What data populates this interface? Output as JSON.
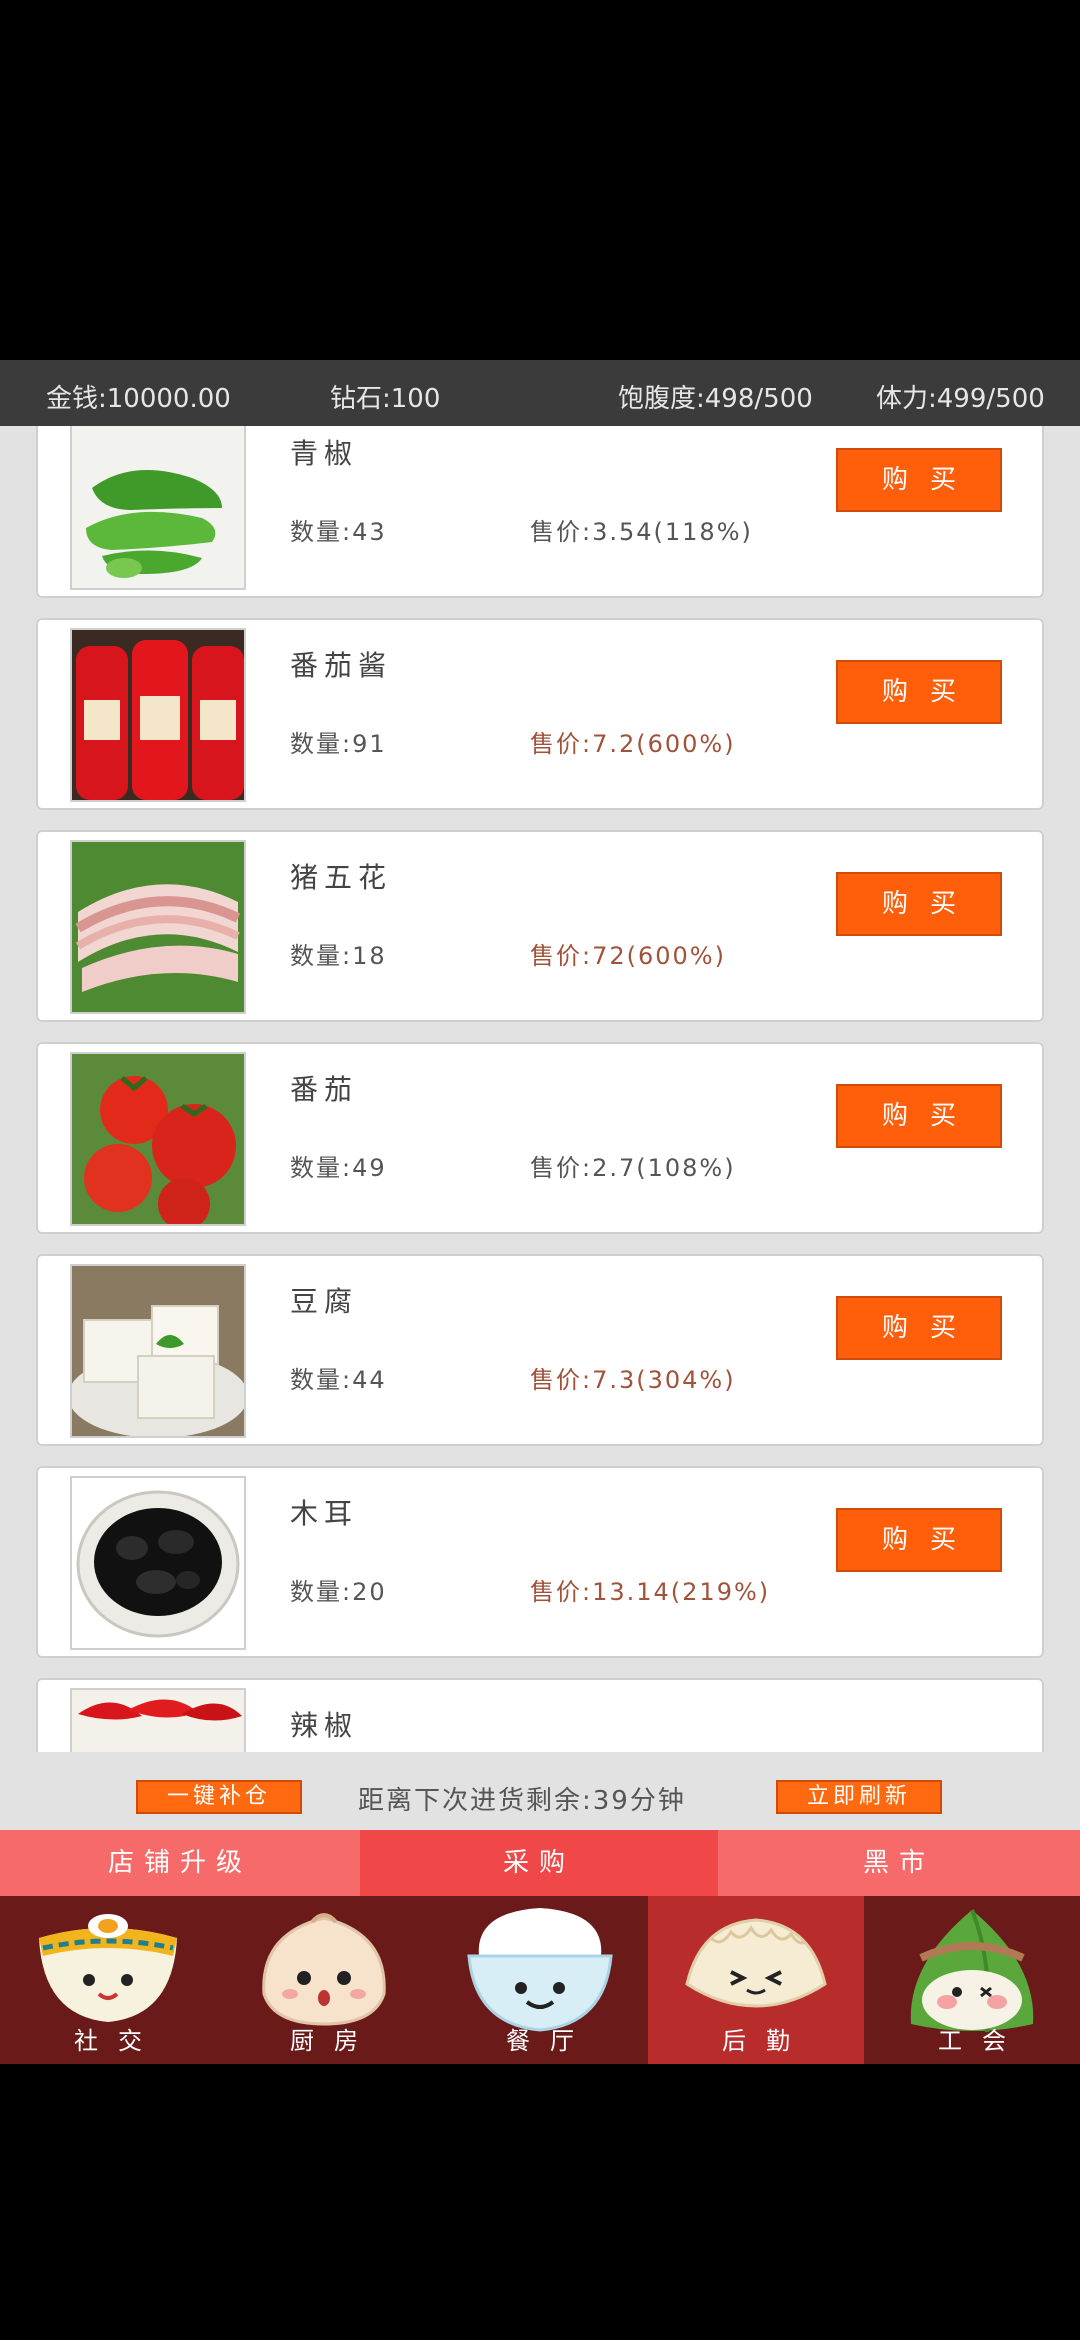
{
  "stats": {
    "money": "金钱:10000.00",
    "diamond": "钻石:100",
    "fullness": "饱腹度:498/500",
    "stamina": "体力:499/500"
  },
  "items": [
    {
      "name": "青椒",
      "qty": "数量:43",
      "price": "售价:3.54(118%)",
      "price_high": false,
      "image": "green-pepper",
      "buy": "购买"
    },
    {
      "name": "番茄酱",
      "qty": "数量:91",
      "price": "售价:7.2(600%)",
      "price_high": true,
      "image": "ketchup",
      "buy": "购买"
    },
    {
      "name": "猪五花",
      "qty": "数量:18",
      "price": "售价:72(600%)",
      "price_high": true,
      "image": "pork-belly",
      "buy": "购买"
    },
    {
      "name": "番茄",
      "qty": "数量:49",
      "price": "售价:2.7(108%)",
      "price_high": false,
      "image": "tomato",
      "buy": "购买"
    },
    {
      "name": "豆腐",
      "qty": "数量:44",
      "price": "售价:7.3(304%)",
      "price_high": true,
      "image": "tofu",
      "buy": "购买"
    },
    {
      "name": "木耳",
      "qty": "数量:20",
      "price": "售价:13.14(219%)",
      "price_high": true,
      "image": "wood-ear",
      "buy": "购买"
    },
    {
      "name": "辣椒",
      "qty": "",
      "price": "",
      "price_high": false,
      "image": "chili",
      "buy": ""
    }
  ],
  "actions": {
    "restock": "一键补仓",
    "countdown": "距离下次进货剩余:39分钟",
    "refresh": "立即刷新"
  },
  "tabs": [
    {
      "label": "店铺升级",
      "active": false
    },
    {
      "label": "采购",
      "active": true
    },
    {
      "label": "黑市",
      "active": false
    }
  ],
  "nav": [
    {
      "label": "社交",
      "icon": "ramen-bowl-icon",
      "active": false
    },
    {
      "label": "厨房",
      "icon": "bun-icon",
      "active": false
    },
    {
      "label": "餐厅",
      "icon": "rice-bowl-icon",
      "active": false
    },
    {
      "label": "后勤",
      "icon": "dumpling-icon",
      "active": true
    },
    {
      "label": "工会",
      "icon": "zongzi-icon",
      "active": false
    }
  ],
  "colors": {
    "buy_button": "#ff5e0a",
    "tab_bar": "#f76a6a",
    "tab_active": "#f04848",
    "nav_bg": "#6b1a1a",
    "nav_active": "#b82c2c",
    "high_price": "#a0523a"
  }
}
